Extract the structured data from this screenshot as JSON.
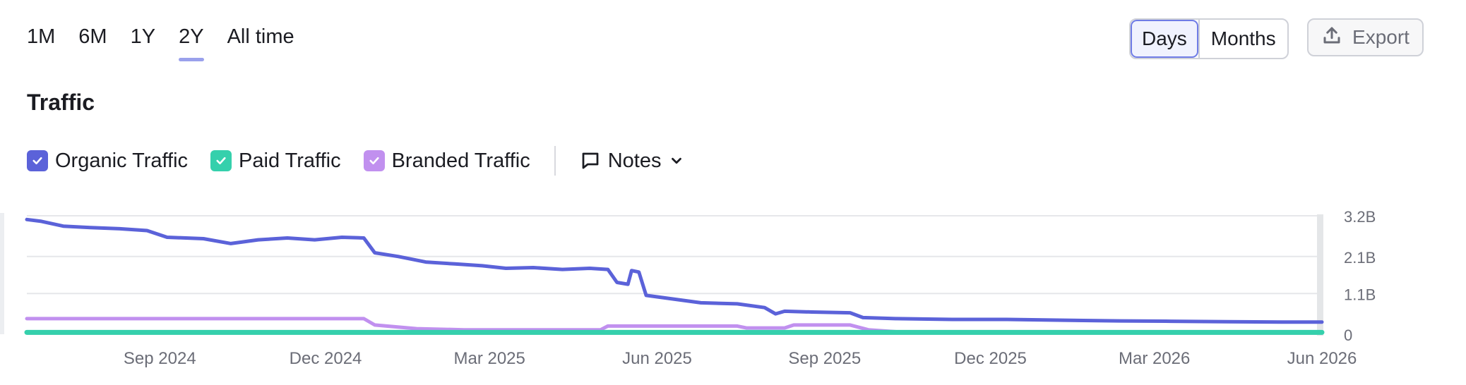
{
  "ranges": [
    "1M",
    "6M",
    "1Y",
    "2Y",
    "All time"
  ],
  "active_range": "2Y",
  "granularity": {
    "options": [
      "Days",
      "Months"
    ],
    "selected": "Days"
  },
  "export_label": "Export",
  "section_title": "Traffic",
  "legend": {
    "items": [
      {
        "label": "Organic Traffic",
        "color": "#5b62d9",
        "checked": true
      },
      {
        "label": "Paid Traffic",
        "color": "#35d0ac",
        "checked": true
      },
      {
        "label": "Branded Traffic",
        "color": "#c190ef",
        "checked": true
      }
    ],
    "notes_label": "Notes"
  },
  "chart_data": {
    "type": "line",
    "x_axis_labels": [
      "Sep 2024",
      "Dec 2024",
      "Mar 2025",
      "Jun 2025",
      "Sep 2025",
      "Dec 2025",
      "Mar 2026",
      "Jun 2026"
    ],
    "y_axis_labels": [
      "3.2B",
      "2.1B",
      "1.1B",
      "0"
    ],
    "ylim": [
      0,
      3.2
    ],
    "y_unit": "B",
    "xlim": [
      "2024-06-20",
      "2026-06-01"
    ],
    "grid": true,
    "series": [
      {
        "name": "Organic Traffic",
        "color": "#5b62d9",
        "points": [
          [
            "2024-06-20",
            3.1
          ],
          [
            "2024-06-28",
            3.05
          ],
          [
            "2024-07-10",
            2.92
          ],
          [
            "2024-07-25",
            2.88
          ],
          [
            "2024-08-10",
            2.85
          ],
          [
            "2024-08-25",
            2.8
          ],
          [
            "2024-09-05",
            2.62
          ],
          [
            "2024-09-25",
            2.58
          ],
          [
            "2024-10-10",
            2.45
          ],
          [
            "2024-10-25",
            2.55
          ],
          [
            "2024-11-10",
            2.6
          ],
          [
            "2024-11-25",
            2.55
          ],
          [
            "2024-12-10",
            2.62
          ],
          [
            "2024-12-22",
            2.6
          ],
          [
            "2024-12-28",
            2.2
          ],
          [
            "2025-01-10",
            2.1
          ],
          [
            "2025-01-25",
            1.95
          ],
          [
            "2025-02-10",
            1.9
          ],
          [
            "2025-02-25",
            1.85
          ],
          [
            "2025-03-10",
            1.78
          ],
          [
            "2025-03-25",
            1.8
          ],
          [
            "2025-04-10",
            1.75
          ],
          [
            "2025-04-25",
            1.78
          ],
          [
            "2025-05-05",
            1.75
          ],
          [
            "2025-05-10",
            1.4
          ],
          [
            "2025-05-16",
            1.35
          ],
          [
            "2025-05-18",
            1.72
          ],
          [
            "2025-05-22",
            1.68
          ],
          [
            "2025-05-26",
            1.05
          ],
          [
            "2025-06-10",
            0.95
          ],
          [
            "2025-06-25",
            0.85
          ],
          [
            "2025-07-15",
            0.82
          ],
          [
            "2025-07-30",
            0.72
          ],
          [
            "2025-08-05",
            0.55
          ],
          [
            "2025-08-10",
            0.62
          ],
          [
            "2025-08-25",
            0.6
          ],
          [
            "2025-09-15",
            0.58
          ],
          [
            "2025-09-22",
            0.45
          ],
          [
            "2025-10-10",
            0.42
          ],
          [
            "2025-11-10",
            0.4
          ],
          [
            "2025-12-10",
            0.4
          ],
          [
            "2026-01-10",
            0.38
          ],
          [
            "2026-02-10",
            0.36
          ],
          [
            "2026-03-10",
            0.35
          ],
          [
            "2026-04-10",
            0.34
          ],
          [
            "2026-05-10",
            0.33
          ],
          [
            "2026-06-01",
            0.33
          ]
        ]
      },
      {
        "name": "Paid Traffic",
        "color": "#35d0ac",
        "points": [
          [
            "2024-06-20",
            0.05
          ],
          [
            "2026-06-01",
            0.05
          ]
        ]
      },
      {
        "name": "Branded Traffic",
        "color": "#c190ef",
        "points": [
          [
            "2024-06-20",
            0.42
          ],
          [
            "2024-09-01",
            0.42
          ],
          [
            "2024-12-22",
            0.42
          ],
          [
            "2024-12-28",
            0.25
          ],
          [
            "2025-01-20",
            0.15
          ],
          [
            "2025-02-15",
            0.12
          ],
          [
            "2025-05-01",
            0.12
          ],
          [
            "2025-05-05",
            0.22
          ],
          [
            "2025-07-15",
            0.22
          ],
          [
            "2025-07-20",
            0.17
          ],
          [
            "2025-08-10",
            0.17
          ],
          [
            "2025-08-15",
            0.25
          ],
          [
            "2025-09-15",
            0.25
          ],
          [
            "2025-09-25",
            0.12
          ],
          [
            "2025-10-15",
            0.05
          ],
          [
            "2026-06-01",
            0.04
          ]
        ]
      }
    ]
  }
}
